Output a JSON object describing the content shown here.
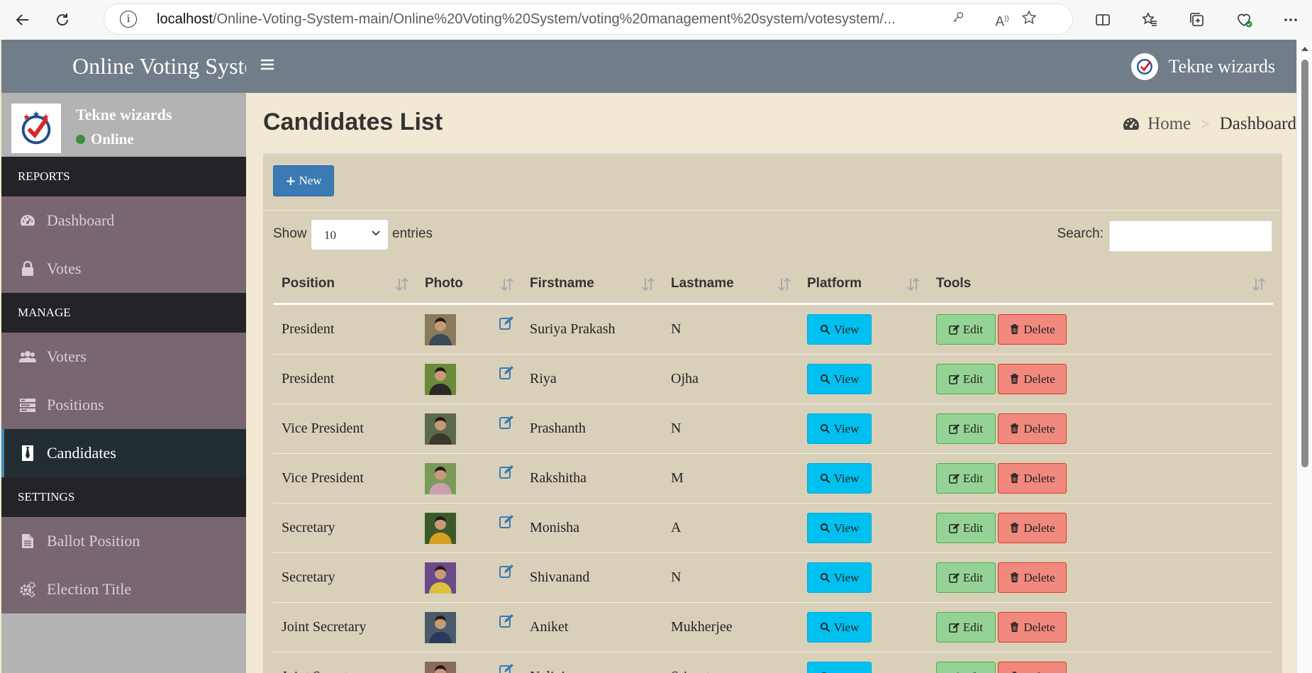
{
  "browser": {
    "url_host": "localhost",
    "url_path": "/Online-Voting-System-main/Online%20Voting%20System/voting%20management%20system/votesystem/..."
  },
  "app": {
    "brand": "Online Voting System",
    "header_username": "Tekne wizards"
  },
  "sidebar": {
    "user_name": "Tekne wizards",
    "status": "Online",
    "sections": [
      {
        "header": "REPORTS",
        "items": [
          {
            "label": "Dashboard",
            "icon": "dashboard-icon"
          },
          {
            "label": "Votes",
            "icon": "lock-icon"
          }
        ]
      },
      {
        "header": "MANAGE",
        "items": [
          {
            "label": "Voters",
            "icon": "users-icon"
          },
          {
            "label": "Positions",
            "icon": "tasks-icon"
          },
          {
            "label": "Candidates",
            "icon": "tie-icon",
            "active": true
          }
        ]
      },
      {
        "header": "SETTINGS",
        "items": [
          {
            "label": "Ballot Position",
            "icon": "file-icon"
          },
          {
            "label": "Election Title",
            "icon": "cogs-icon"
          }
        ]
      }
    ]
  },
  "page": {
    "title": "Candidates List",
    "breadcrumb": {
      "home": "Home",
      "current": "Dashboard"
    }
  },
  "toolbar": {
    "new_label": "New"
  },
  "datatable": {
    "show_label": "Show",
    "length_value": "10",
    "entries_label": "entries",
    "search_label": "Search:",
    "search_value": ""
  },
  "table": {
    "columns": [
      "Position",
      "Photo",
      "Firstname",
      "Lastname",
      "Platform",
      "Tools"
    ],
    "view_label": "View",
    "edit_label": "Edit",
    "delete_label": "Delete",
    "rows": [
      {
        "position": "President",
        "firstname": "Suriya Prakash",
        "lastname": "N"
      },
      {
        "position": "President",
        "firstname": "Riya",
        "lastname": "Ojha"
      },
      {
        "position": "Vice President",
        "firstname": "Prashanth",
        "lastname": "N"
      },
      {
        "position": "Vice President",
        "firstname": "Rakshitha",
        "lastname": "M"
      },
      {
        "position": "Secretary",
        "firstname": "Monisha",
        "lastname": "A"
      },
      {
        "position": "Secretary",
        "firstname": "Shivanand",
        "lastname": "N"
      },
      {
        "position": "Joint Secretary",
        "firstname": "Aniket",
        "lastname": "Mukherjee"
      },
      {
        "position": "Joint Secretary",
        "firstname": "Nalini",
        "lastname": "Srivastava"
      }
    ]
  },
  "colors": {
    "topbar": "#717d88",
    "sidebar_item": "#786671",
    "sidebar_header": "#242428",
    "content_bg": "#f1e9d3",
    "box_bg": "#d9d0b9",
    "view_button": "#00c0ef",
    "edit_button": "#95d295",
    "delete_button": "#f1897e",
    "new_button": "#3c7ab3"
  }
}
